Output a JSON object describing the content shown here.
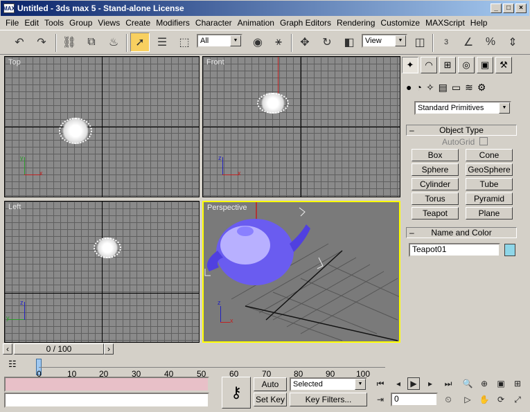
{
  "window": {
    "title": "Untitled - 3ds max 5 - Stand-alone License",
    "app_icon": "MAX"
  },
  "window_controls": {
    "minimize": "_",
    "maximize": "□",
    "close": "×"
  },
  "menu": [
    "File",
    "Edit",
    "Tools",
    "Group",
    "Views",
    "Create",
    "Modifiers",
    "Character",
    "Animation",
    "Graph Editors",
    "Rendering",
    "Customize",
    "MAXScript",
    "Help"
  ],
  "toolbar": {
    "selection_filter": "All",
    "reference_coord": "View",
    "snaps": {
      "angle": "3",
      "percent": "%"
    }
  },
  "viewports": {
    "top": "Top",
    "front": "Front",
    "left": "Left",
    "perspective": "Perspective"
  },
  "axes": {
    "x": "x",
    "y": "y",
    "z": "z"
  },
  "command_panel": {
    "tabs": [
      "create-icon",
      "modify-icon",
      "hierarchy-icon",
      "motion-icon",
      "display-icon",
      "utilities-icon"
    ],
    "category": "Standard Primitives",
    "object_type": {
      "header": "Object Type",
      "autogrid": "AutoGrid",
      "buttons": [
        "Box",
        "Cone",
        "Sphere",
        "GeoSphere",
        "Cylinder",
        "Tube",
        "Torus",
        "Pyramid",
        "Teapot",
        "Plane"
      ]
    },
    "name_color": {
      "header": "Name and Color",
      "name": "Teapot01",
      "swatch": "#8ed6e8"
    }
  },
  "timeline": {
    "frame_display": "0 / 100",
    "ticks": [
      "0",
      "10",
      "20",
      "30",
      "40",
      "50",
      "60",
      "70",
      "80",
      "90",
      "100"
    ]
  },
  "animation": {
    "auto_key": "Auto Key",
    "set_key": "Set Key",
    "key_mode": "Selected",
    "key_filters": "Key Filters...",
    "current_frame": "0"
  },
  "colors": {
    "selection_yellow": "#ffff00",
    "teapot_blue": "#6a5cf0",
    "active_button": "#f8d060"
  }
}
